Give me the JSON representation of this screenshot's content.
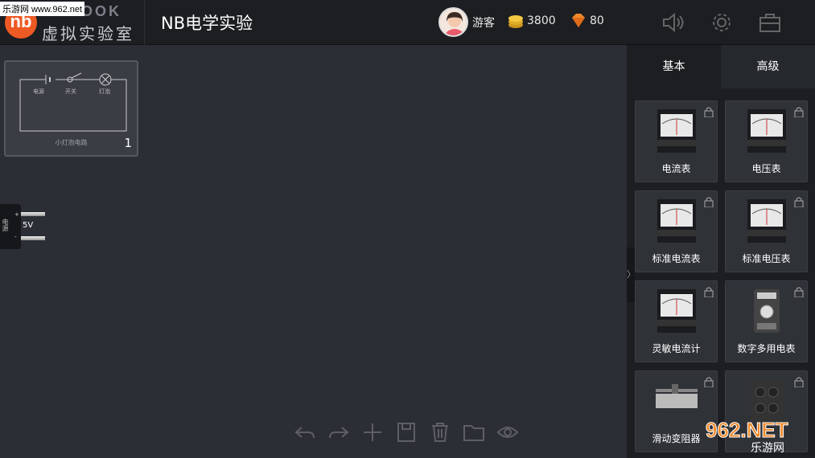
{
  "header": {
    "logo_mark": "nb",
    "logo_en": "NOBOOK",
    "logo_cn": "虚拟实验室",
    "title": "NB电学实验",
    "user": "游客",
    "coins": "3800",
    "gems": "80",
    "watermark": "乐游网 www.962.net"
  },
  "canvas": {
    "card": {
      "labels": [
        "电源",
        "开关",
        "灯泡"
      ],
      "name": "小灯泡电路",
      "num": "1"
    },
    "power": {
      "label": "电源",
      "volt": "5V",
      "plus": "+",
      "minus": "-"
    }
  },
  "sidebar": {
    "tabs": [
      "基本",
      "高级"
    ],
    "toggle": "〉",
    "parts": [
      "电流表",
      "电压表",
      "标准电流表",
      "标准电压表",
      "灵敏电流计",
      "数字多用电表",
      "滑动变阻器",
      ""
    ]
  },
  "watermark_br": {
    "big": "962.NET",
    "small": "乐游网"
  }
}
